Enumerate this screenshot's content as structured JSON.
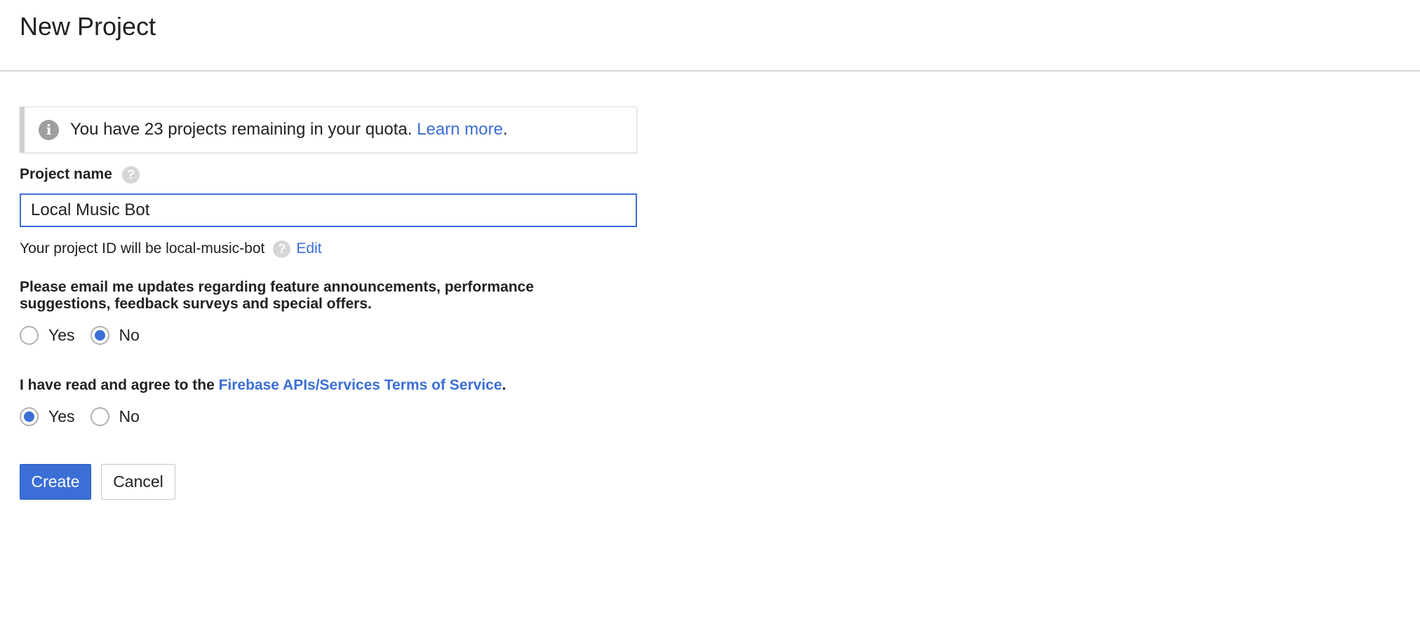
{
  "header": {
    "title": "New Project"
  },
  "notice": {
    "icon": "info-icon",
    "text": "You have 23 projects remaining in your quota.",
    "link_label": "Learn more",
    "suffix": "."
  },
  "project_name": {
    "label": "Project name",
    "help_icon": "?",
    "value": "Local Music Bot"
  },
  "project_id": {
    "text": "Your project ID will be local-music-bot",
    "help_icon": "?",
    "edit_label": "Edit"
  },
  "email_updates": {
    "question": "Please email me updates regarding feature announcements, performance suggestions, feedback surveys and special offers.",
    "options": [
      "Yes",
      "No"
    ],
    "selected": "No"
  },
  "terms": {
    "prefix": "I have read and agree to the ",
    "link_label": "Firebase APIs/Services Terms of Service",
    "suffix": ".",
    "options": [
      "Yes",
      "No"
    ],
    "selected": "Yes"
  },
  "buttons": {
    "create": "Create",
    "cancel": "Cancel"
  },
  "colors": {
    "accent": "#3b6ed6",
    "divider": "#d6d6d6"
  }
}
